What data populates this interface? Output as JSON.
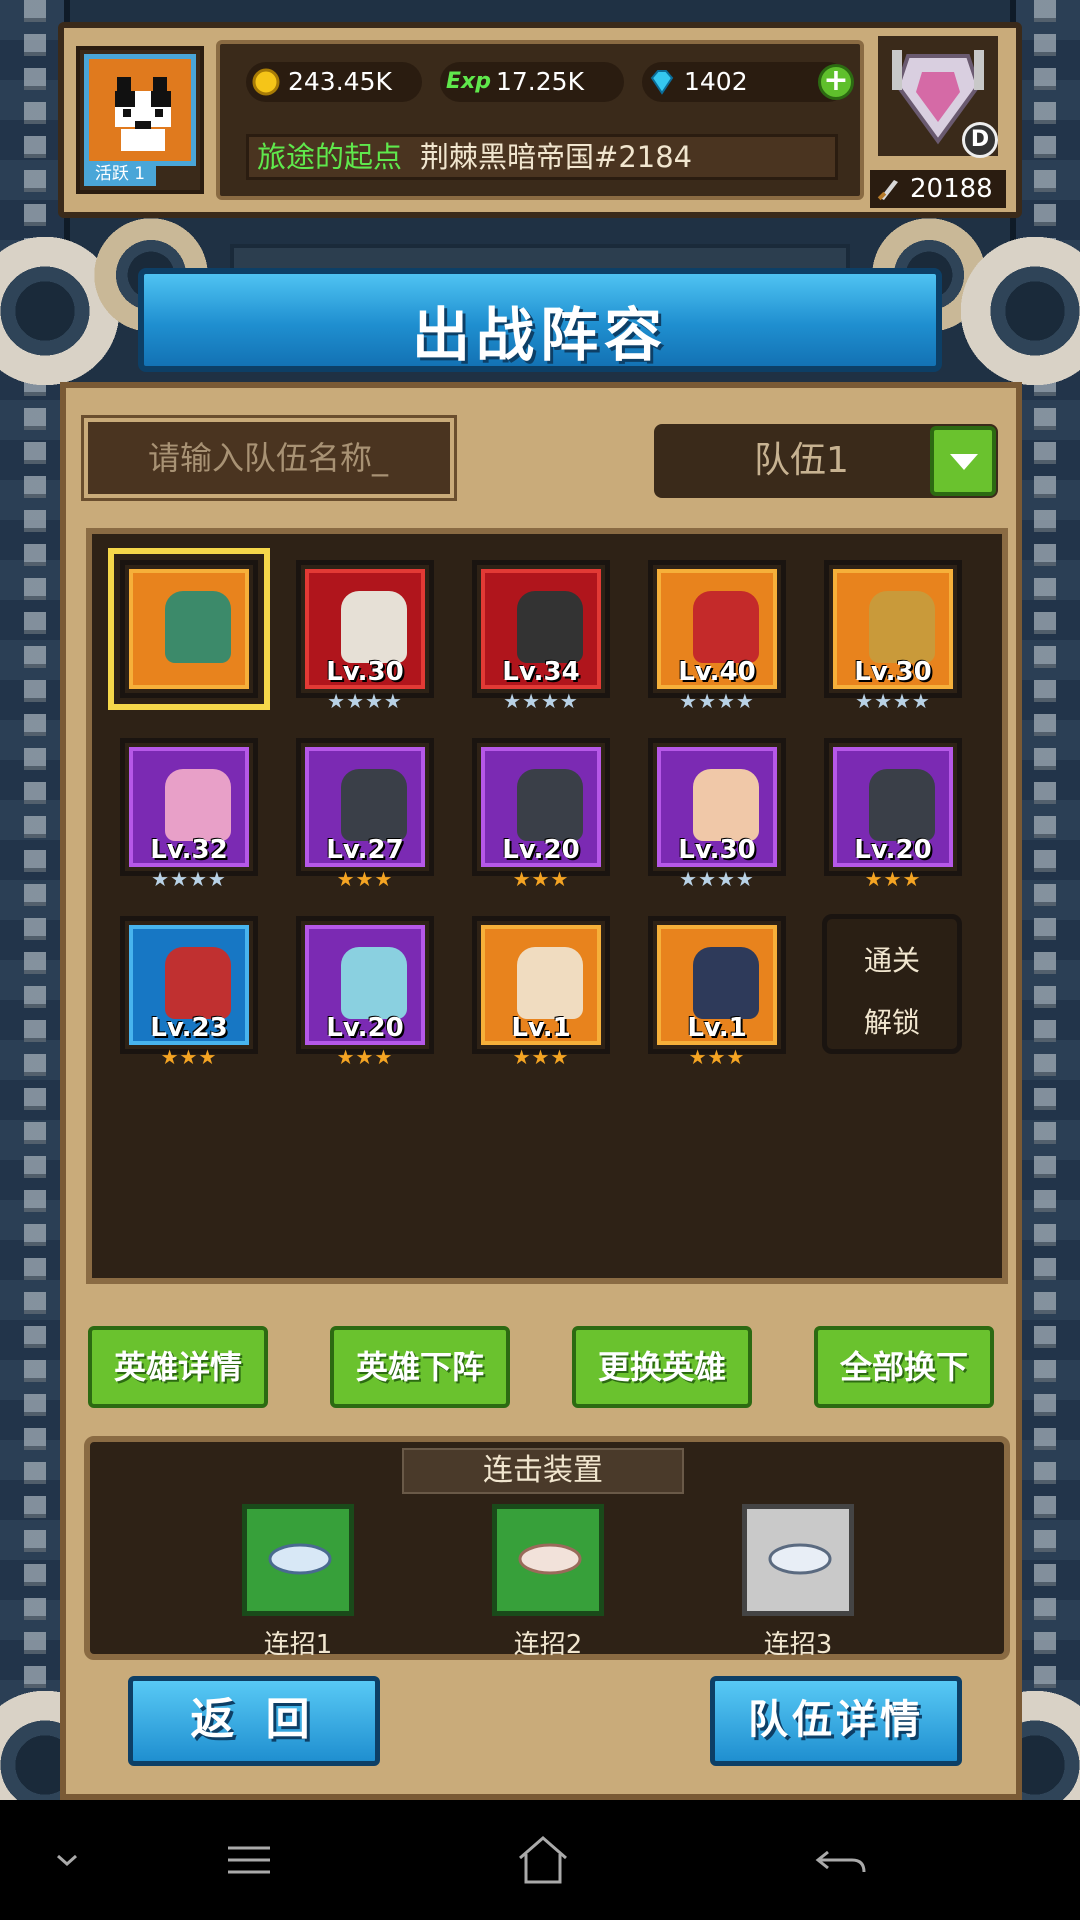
{
  "header": {
    "active_label": "活跃 1",
    "gold": "243.45K",
    "exp_label": "Exp",
    "exp": "17.25K",
    "diamonds": "1402",
    "location_name": "旅途的起点",
    "server_name": "荆棘黑暗帝国#2184",
    "rank": "D",
    "power": "20188"
  },
  "banner": {
    "title": "出战阵容"
  },
  "team": {
    "name_placeholder": "请输入队伍名称_",
    "selected": "队伍1"
  },
  "heroes": [
    {
      "level": "",
      "stars": "",
      "rarity": "orange",
      "selected": true
    },
    {
      "level": "Lv.30",
      "stars": "★★★★",
      "rarity": "red"
    },
    {
      "level": "Lv.34",
      "stars": "★★★★",
      "rarity": "red"
    },
    {
      "level": "Lv.40",
      "stars": "★★★★",
      "rarity": "orange"
    },
    {
      "level": "Lv.30",
      "stars": "★★★★",
      "rarity": "orange"
    },
    {
      "level": "Lv.32",
      "stars": "★★★★",
      "rarity": "purple"
    },
    {
      "level": "Lv.27",
      "stars": "★★★",
      "rarity": "purple"
    },
    {
      "level": "Lv.20",
      "stars": "★★★",
      "rarity": "purple"
    },
    {
      "level": "Lv.30",
      "stars": "★★★★",
      "rarity": "purple"
    },
    {
      "level": "Lv.20",
      "stars": "★★★",
      "rarity": "purple"
    },
    {
      "level": "Lv.23",
      "stars": "★★★",
      "rarity": "blue"
    },
    {
      "level": "Lv.20",
      "stars": "★★★",
      "rarity": "purple"
    },
    {
      "level": "Lv.1",
      "stars": "★★★",
      "rarity": "orange"
    },
    {
      "level": "Lv.1",
      "stars": "★★★",
      "rarity": "orange"
    }
  ],
  "locked_slot": {
    "line1": "通关",
    "line2": "解锁"
  },
  "actions": {
    "hero_detail": "英雄详情",
    "hero_remove": "英雄下阵",
    "hero_swap": "更换英雄",
    "swap_all": "全部换下"
  },
  "combo": {
    "title": "连击装置",
    "slots": [
      "连招1",
      "连招2",
      "连招3"
    ]
  },
  "bottom": {
    "back": "返 回",
    "team_detail": "队伍详情"
  },
  "colors": {
    "rarity_orange": "#e8831d",
    "rarity_red": "#b0151c",
    "rarity_purple": "#7b2ab3",
    "rarity_blue": "#1777c4",
    "button_green": "#6ac22e",
    "button_blue": "#1f8fd0"
  },
  "icons": [
    "gold-coin-icon",
    "exp-icon",
    "diamond-icon",
    "plus-icon",
    "sword-icon",
    "dropdown-arrow-icon",
    "ocarina-icon",
    "nav-collapse-icon",
    "nav-menu-icon",
    "nav-home-icon",
    "nav-back-icon"
  ]
}
